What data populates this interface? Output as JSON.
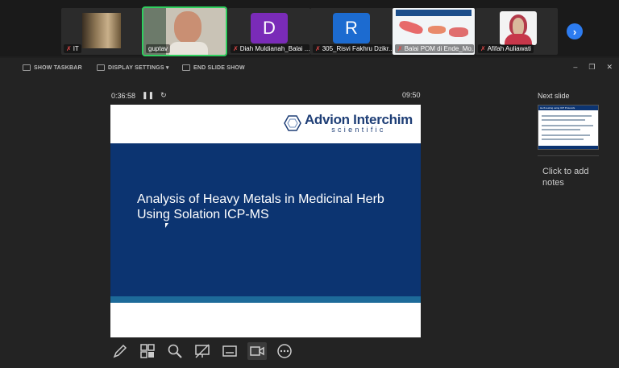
{
  "participants": [
    {
      "name": "IT",
      "muted": true,
      "kind": "photo"
    },
    {
      "name": "guptav",
      "muted": false,
      "kind": "video",
      "active": true
    },
    {
      "name": "Diah Muldianah_Balai ...",
      "muted": true,
      "kind": "letter",
      "letter": "D",
      "color": "#7a2bb8"
    },
    {
      "name": "305_Risvi Fakhru Dzikr...",
      "muted": true,
      "kind": "letter",
      "letter": "R",
      "color": "#1c6bd0"
    },
    {
      "name": "Balai POM di Ende_Mo...",
      "muted": true,
      "kind": "map"
    },
    {
      "name": "Afifah Auliawati",
      "muted": true,
      "kind": "person"
    }
  ],
  "toolbar": {
    "show_taskbar": "SHOW TASKBAR",
    "display_settings": "DISPLAY SETTINGS ▾",
    "end_slide_show": "END SLIDE SHOW"
  },
  "timer": "0:36:58",
  "clock": "09:50",
  "slide": {
    "logo_main": "Advion Interchim",
    "logo_sub": "scientific",
    "title": "Analysis of Heavy Metals in Medicinal Herb Using Solation ICP-MS"
  },
  "next_slide": {
    "label": "Next slide",
    "thumb_title": "Herb testing using ICP Protocols"
  },
  "notes": "Click to add notes",
  "tools": [
    "pen-icon",
    "see-all-slides-icon",
    "zoom-icon",
    "black-screen-icon",
    "subtitles-icon",
    "camera-icon",
    "more-options-icon"
  ],
  "colors": {
    "slide_band": "#0c3471",
    "accent": "#2d7cf0",
    "active_speaker": "#2fcf5f"
  }
}
